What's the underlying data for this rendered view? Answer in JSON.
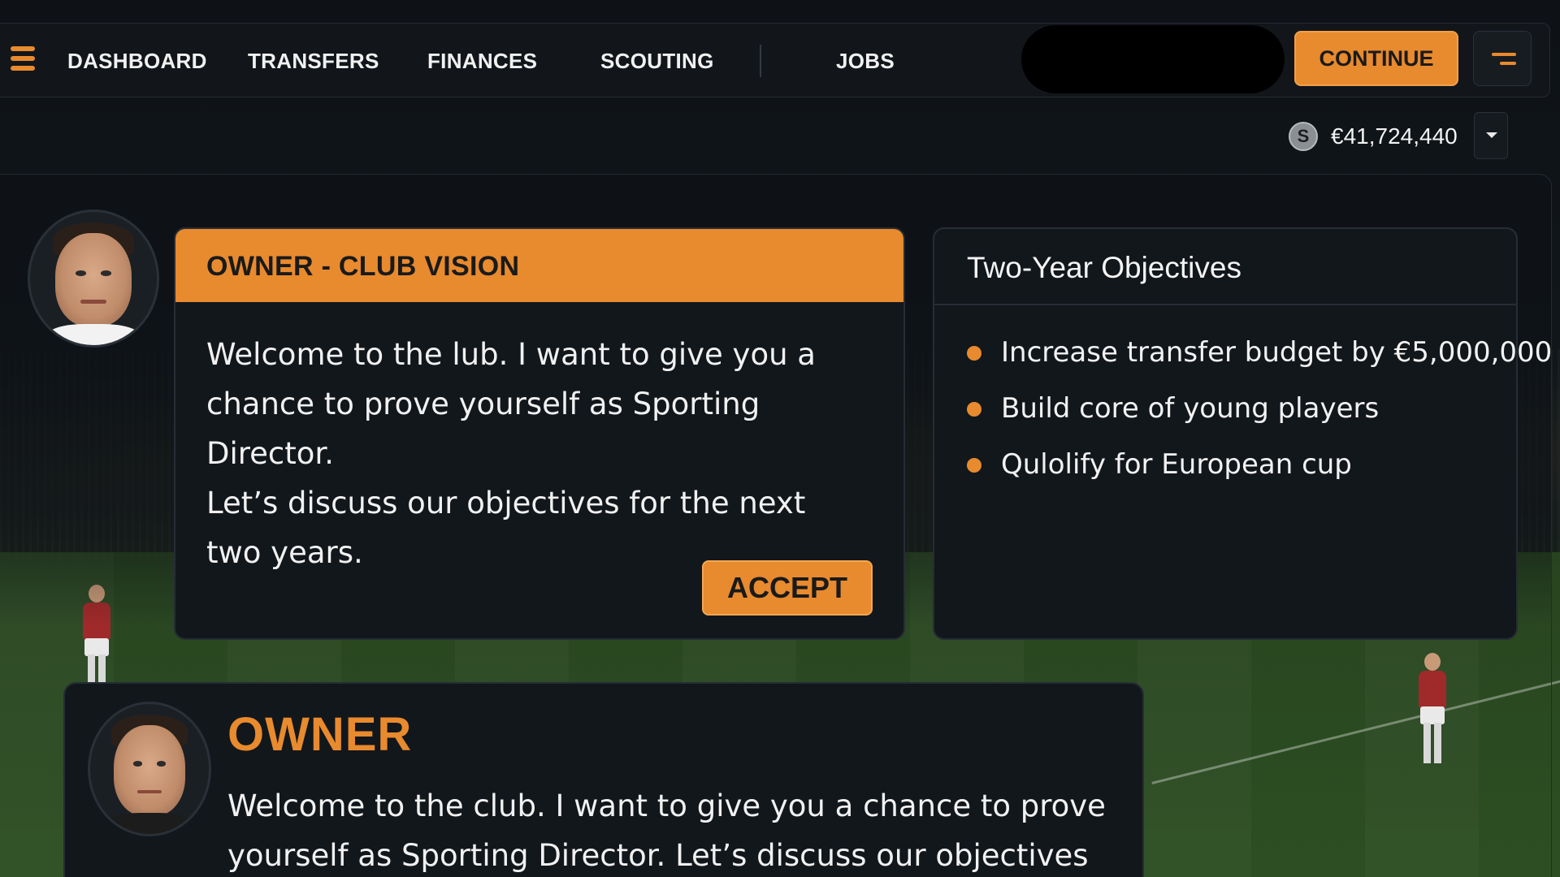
{
  "nav": {
    "items": [
      "DASHBOARD",
      "TRANSFERS",
      "FINANCES",
      "SCOUTING",
      "JOBS"
    ],
    "continue_label": "CONTINUE",
    "menu_icon": "hamburger-icon",
    "right_menu_icon": "menu-lines-icon"
  },
  "balance": {
    "coin_symbol": "S",
    "amount": "€41,724,440"
  },
  "vision": {
    "title": "OWNER - CLUB VISION",
    "body": "Welcome to the lub. I want to give you a\nchance to prove yourself as Sporting Director.\nLet’s discuss our objectives for the next\ntwo years.",
    "accept_label": "ACCEPT"
  },
  "objectives": {
    "title": "Two-Year Objectives",
    "items": [
      "Increase transfer budget by €5,000,000",
      "Build core of young players",
      "Qulolify for European cup"
    ]
  },
  "owner": {
    "name": "OWNER",
    "message": "Welcome to the club. I want to give you a chance to prove\nyourself as Sporting Director. Let’s discuss our objectives"
  },
  "colors": {
    "accent": "#e88a2e",
    "panel": "#12171c",
    "background": "#0d1014"
  }
}
